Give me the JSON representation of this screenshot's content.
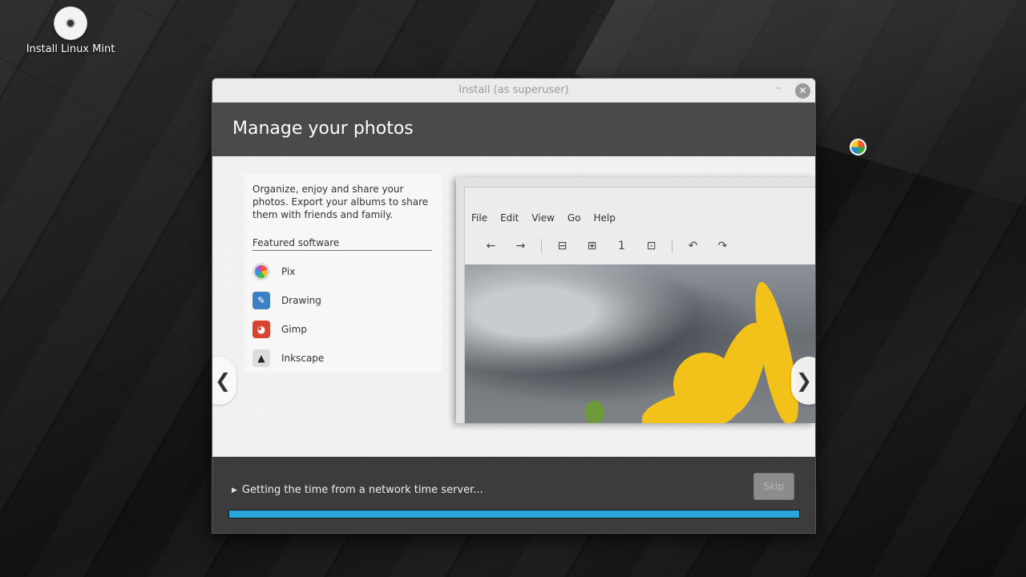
{
  "desktop": {
    "icon_label": "Install Linux Mint"
  },
  "window": {
    "title": "Install (as superuser)",
    "minimize_glyph": "–",
    "close_glyph": "✕"
  },
  "slide": {
    "heading": "Manage your photos",
    "description": "Organize, enjoy and share your photos. Export your albums to share them with friends and family.",
    "featured_label": "Featured software",
    "apps": [
      {
        "name": "Pix",
        "icon": "pix-icon"
      },
      {
        "name": "Drawing",
        "icon": "drawing-icon"
      },
      {
        "name": "Gimp",
        "icon": "gimp-icon"
      },
      {
        "name": "Inkscape",
        "icon": "inkscape-icon"
      }
    ],
    "prev_glyph": "❮",
    "next_glyph": "❯"
  },
  "preview": {
    "menu": [
      "File",
      "Edit",
      "View",
      "Go",
      "Help"
    ],
    "tools": [
      "←",
      "→",
      "⊟",
      "⊞",
      "1",
      "⊡",
      "↶",
      "↷"
    ]
  },
  "footer": {
    "status_text": "Getting the time from a network time server...",
    "skip_label": "Skip",
    "progress": 1.0,
    "accent_color": "#2aa6dd"
  }
}
